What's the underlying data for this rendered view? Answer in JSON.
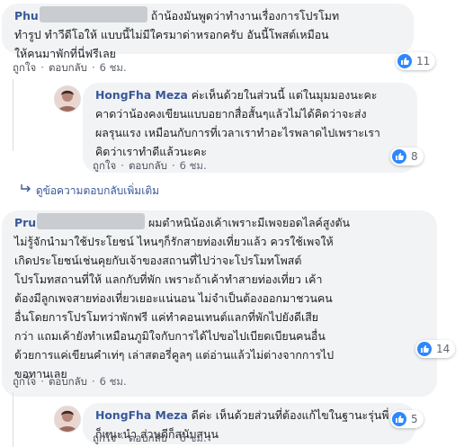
{
  "comments": [
    {
      "author_visible": "Phu",
      "text": "ถ้าน้องมันพูดว่าทำงานเรื่องการโปรโมท\nทำรูป ทำวีดีโอให้ แบบนี้ไม่มีใครมาด่าหรอกครับ อันนี้โพสต์เหมือน\nให้คนมาพักที่นี่ฟรีเลย",
      "actions": {
        "like": "ถูกใจ",
        "reply": "ตอบกลับ",
        "time": "6 ชม."
      },
      "reactions": "11"
    },
    {
      "author_visible": "HongFha Meza",
      "text": "ค่ะเห็นด้วยในส่วนนี้ แต่ในมุมมองนะคะ\nคาดว่าน้องคงเขียนแบบอยากสื่อสั้นๆแล้วไม่ได้คิดว่าจะส่ง\nผลรุนแรง เหมือนกับการที่เวลาเราทำอะไรพลาดไปเพราะเรา\nคิดว่าเราทำดีแล้วนะคะ",
      "actions": {
        "like": "ถูกใจ",
        "reply": "ตอบกลับ",
        "time": "6 ชม."
      },
      "reactions": "8"
    },
    {
      "author_visible": "Pru",
      "text": "ผมตำหนิน้องเค้าเพราะมีเพจยอดไลค์สูงตัน\nไม่รู้จักนำมาใช้ประโยชน์ ไหนๆก็รักสายท่องเที่ยวแล้ว ควรใช้เพจให้\nเกิดประโยชน์เช่นคุยกับเจ้าของสถานที่ไปว่าจะโปรโมทโพสต์\nโปรโมทสถานที่ให้ แลกกับที่พัก เพราะถ้าเค้าทำสายท่องเที่ยว เค้า\nต้องมีลูกเพจสายท่องเที่ยวเยอะแน่นอน ไม่จำเป็นต้องออกมาชวนคน\nอื่นโดยการโปรโมทว่าพักฟรี แค่ทำคอนเทนต์แลกที่พักไปยังดีเสีย\nกว่า แถมเค้ายังทำเหมือนภูมิใจกับการได้ไปขอไปเบียดเบียนคนอื่น\nด้วยการแค่เขียนคำเท่ๆ เล่าสตอรี่คูลๆ แต่อ่านแล้วไม่ต่างจากการไป\nขอทานเลย",
      "actions": {
        "like": "ถูกใจ",
        "reply": "ตอบกลับ",
        "time": "6 ชม."
      },
      "reactions": "14"
    },
    {
      "author_visible": "HongFha Meza",
      "text": "ดีค่ะ เห็นด้วยส่วนที่ต้องแก้ไขในฐานะรุ่นพี่\nก็แนะนำ ส่วนดีก็สนับสนุน",
      "actions": {
        "like": "ถูกใจ",
        "reply": "ตอบกลับ",
        "time": "6 ชม."
      },
      "reactions": "5"
    }
  ],
  "more_replies": "ดูข้อความตอบกลับเพิ่มเติม",
  "colors": {
    "name": "#385898",
    "bubble": "#f2f3f5",
    "like": "#2d88ff"
  },
  "icons": {
    "like": "like-icon",
    "reply": "reply-arrow-icon",
    "avatar": "avatar"
  }
}
